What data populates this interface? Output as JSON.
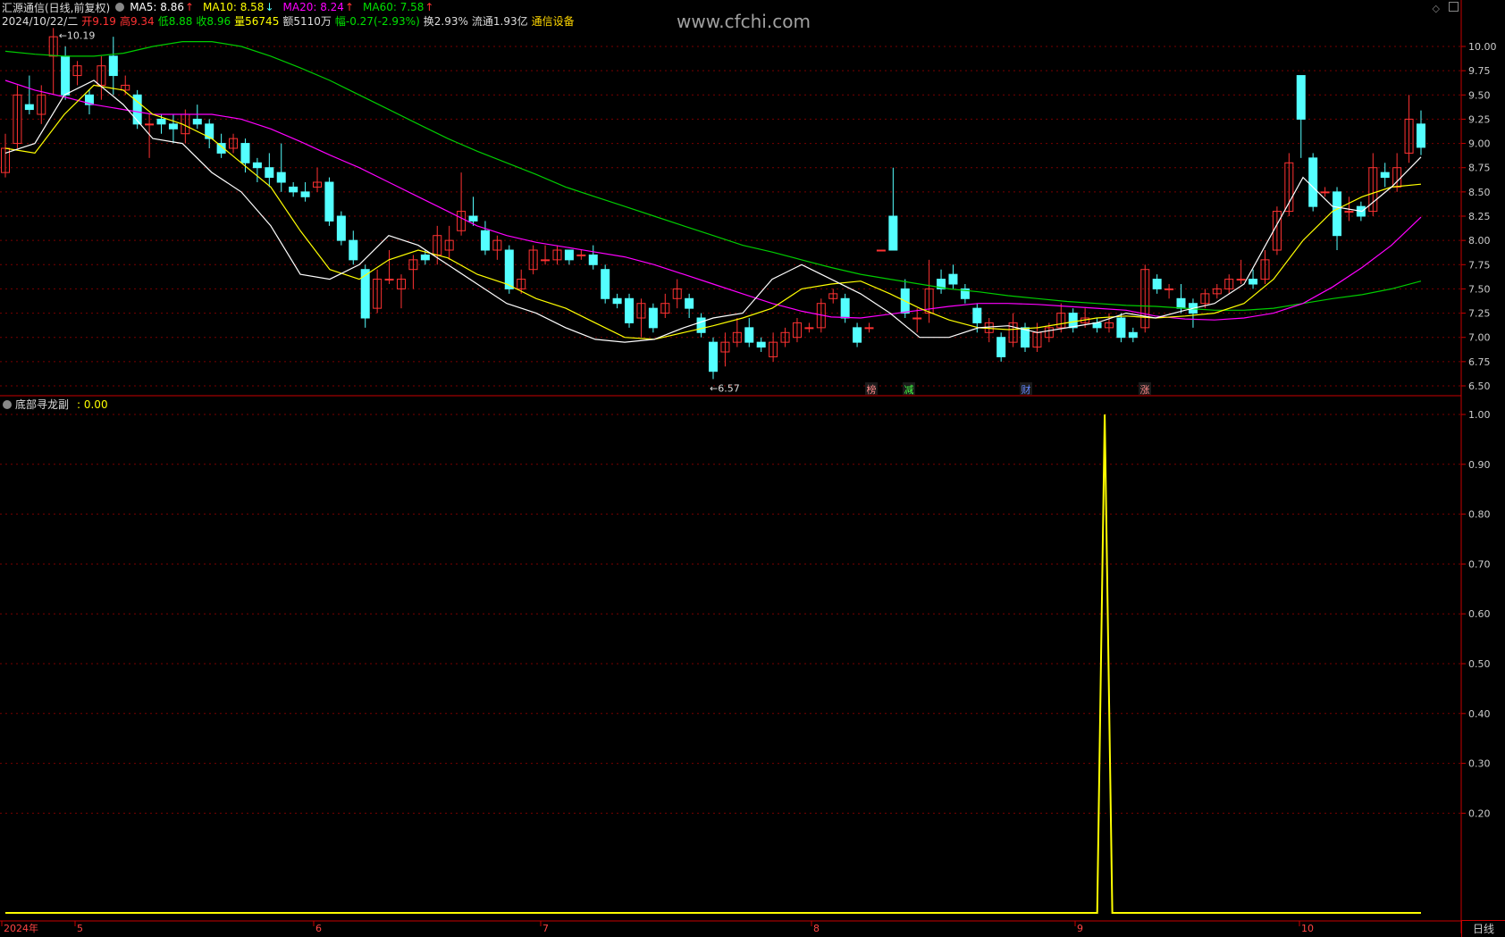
{
  "header": {
    "stock_title": "汇源通信(日线,前复权)",
    "ma5_label": "MA5: 8.86",
    "ma10_label": "MA10: 8.58",
    "ma20_label": "MA20: 8.24",
    "ma60_label": "MA60: 7.58",
    "date": "2024/10/22/二",
    "open": "开9.19",
    "high": "高9.34",
    "low": "低8.88",
    "close": "收8.96",
    "volume": "量56745",
    "amount": "额5110万",
    "change": "幅-0.27(-2.93%)",
    "turnover": "换2.93%",
    "float_cap": "流通1.93亿",
    "sector": "通信设备"
  },
  "watermark": "www.cfchi.com",
  "main_chart": {
    "price_ticks": [
      "10.00",
      "9.75",
      "9.50",
      "9.25",
      "9.00",
      "8.75",
      "8.50",
      "8.25",
      "8.00",
      "7.75",
      "7.50",
      "7.25",
      "7.00",
      "6.75",
      "6.50"
    ],
    "high_marker": "10.19",
    "low_marker": "6.57",
    "event_tags": [
      "榜",
      "减",
      "财",
      "涨"
    ]
  },
  "sub_chart": {
    "title": "底部寻龙副",
    "value": ": 0.00",
    "ticks": [
      "1.00",
      "0.90",
      "0.80",
      "0.70",
      "0.60",
      "0.50",
      "0.40",
      "0.30",
      "0.20"
    ]
  },
  "time_axis": {
    "labels": [
      "2024年",
      "5",
      "6",
      "7",
      "8",
      "9",
      "10"
    ]
  },
  "corner_label": "日线",
  "colors": {
    "up": "#ff3232",
    "down": "#54ffff",
    "ma5": "#ffffff",
    "ma10": "#ffff00",
    "ma20": "#ff00ff",
    "ma60": "#00cc00",
    "axis": "#c80000",
    "grid": "#7a0000",
    "indicator": "#ffff00"
  },
  "chart_data": [
    {
      "type": "line",
      "title": "",
      "ylim": [
        6.5,
        10.0
      ],
      "series": [
        {
          "name": "MA60",
          "values": [
            9.95,
            9.92,
            9.9,
            9.9,
            9.93,
            10.0,
            10.05,
            10.05,
            10.0,
            9.9,
            9.78,
            9.65,
            9.5,
            9.35,
            9.2,
            9.05,
            8.92,
            8.8,
            8.68,
            8.55,
            8.45,
            8.35,
            8.25,
            8.15,
            8.05,
            7.95,
            7.88,
            7.8,
            7.72,
            7.65,
            7.6,
            7.55,
            7.5,
            7.47,
            7.43,
            7.4,
            7.37,
            7.35,
            7.33,
            7.32,
            7.3,
            7.28,
            7.28,
            7.3,
            7.35,
            7.4,
            7.44,
            7.5,
            7.58
          ]
        },
        {
          "name": "MA20",
          "values": [
            9.65,
            9.55,
            9.48,
            9.4,
            9.35,
            9.3,
            9.3,
            9.3,
            9.25,
            9.15,
            9.02,
            8.88,
            8.75,
            8.6,
            8.45,
            8.3,
            8.15,
            8.05,
            7.98,
            7.93,
            7.88,
            7.83,
            7.75,
            7.65,
            7.55,
            7.45,
            7.35,
            7.27,
            7.21,
            7.2,
            7.24,
            7.28,
            7.32,
            7.35,
            7.35,
            7.34,
            7.32,
            7.3,
            7.28,
            7.22,
            7.19,
            7.18,
            7.2,
            7.25,
            7.35,
            7.52,
            7.72,
            7.95,
            8.24
          ]
        },
        {
          "name": "MA10",
          "values": [
            8.95,
            8.9,
            9.3,
            9.6,
            9.55,
            9.3,
            9.2,
            9.05,
            8.8,
            8.55,
            8.1,
            7.7,
            7.6,
            7.8,
            7.9,
            7.82,
            7.65,
            7.55,
            7.4,
            7.3,
            7.15,
            7.0,
            6.98,
            7.05,
            7.12,
            7.2,
            7.3,
            7.5,
            7.55,
            7.58,
            7.45,
            7.3,
            7.18,
            7.1,
            7.08,
            7.1,
            7.15,
            7.2,
            7.22,
            7.2,
            7.22,
            7.25,
            7.35,
            7.6,
            8.0,
            8.3,
            8.45,
            8.55,
            8.58
          ]
        },
        {
          "name": "MA5",
          "values": [
            8.9,
            9.0,
            9.5,
            9.65,
            9.4,
            9.05,
            9.0,
            8.7,
            8.5,
            8.15,
            7.65,
            7.6,
            7.75,
            8.05,
            7.95,
            7.75,
            7.55,
            7.35,
            7.25,
            7.1,
            6.98,
            6.95,
            6.98,
            7.1,
            7.2,
            7.25,
            7.6,
            7.75,
            7.6,
            7.45,
            7.25,
            7.0,
            7.0,
            7.1,
            7.12,
            7.05,
            7.1,
            7.15,
            7.25,
            7.2,
            7.28,
            7.35,
            7.55,
            8.1,
            8.65,
            8.35,
            8.3,
            8.55,
            8.86
          ]
        }
      ]
    },
    {
      "type": "line",
      "title": "底部寻龙副",
      "ylim": [
        0,
        1.0
      ],
      "series": [
        {
          "name": "底部寻龙副",
          "values": [
            0,
            0,
            0,
            0,
            0,
            0,
            0,
            0,
            0,
            0,
            0,
            0,
            0,
            0,
            0,
            0,
            0,
            0,
            0,
            0,
            0,
            0,
            0,
            0,
            0,
            0,
            0,
            0,
            0,
            0,
            0,
            0,
            0,
            0,
            0,
            0,
            0,
            0,
            0,
            0,
            0,
            0,
            0,
            0,
            0,
            0,
            0,
            0,
            0,
            0,
            0,
            0,
            0,
            0,
            0,
            0,
            0,
            0,
            0,
            0,
            0,
            0,
            0,
            0,
            0,
            0,
            0,
            0,
            0,
            0,
            0,
            0,
            0,
            0,
            0,
            0,
            0,
            0,
            0,
            0,
            0,
            0,
            0,
            0,
            0,
            0,
            0,
            0,
            0,
            0,
            0,
            0,
            0,
            0,
            0,
            0,
            0,
            0,
            0,
            0,
            0,
            0,
            0,
            0,
            0,
            0,
            0,
            0,
            0,
            0,
            0,
            0,
            0,
            0,
            0,
            0,
            0,
            0,
            0,
            0,
            0,
            0,
            0,
            0,
            0,
            0,
            0,
            0,
            0,
            0,
            0,
            0,
            0,
            0,
            0,
            0,
            0,
            0,
            0,
            0,
            0,
            0,
            0,
            0,
            0,
            0,
            1.0,
            0,
            0,
            0,
            0,
            0,
            0,
            0,
            0,
            0,
            0,
            0,
            0,
            0,
            0,
            0,
            0,
            0,
            0,
            0,
            0,
            0,
            0,
            0,
            0,
            0,
            0,
            0,
            0,
            0,
            0,
            0,
            0,
            0,
            0,
            0,
            0,
            0,
            0,
            0,
            0,
            0,
            0
          ]
        }
      ]
    }
  ]
}
